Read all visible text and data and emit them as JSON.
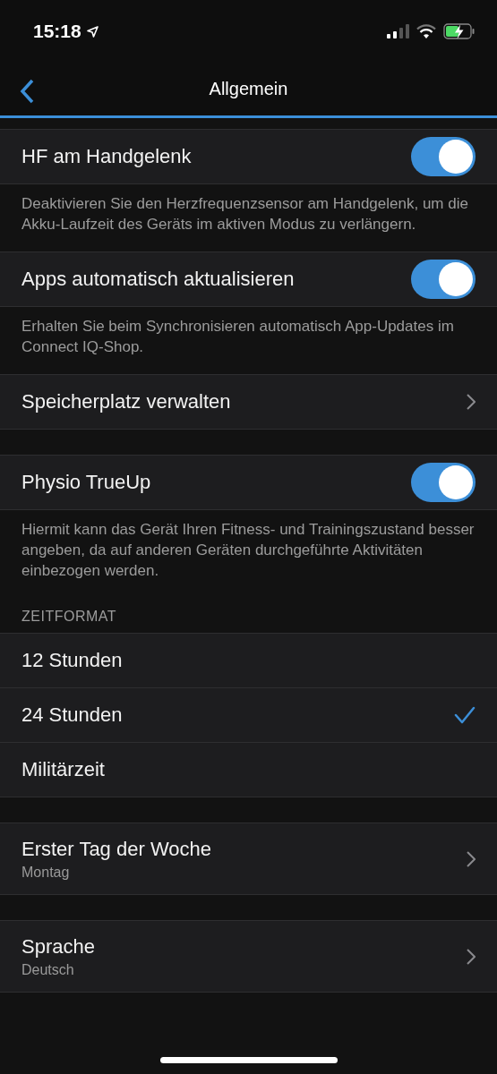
{
  "status_bar": {
    "time": "15:18"
  },
  "nav": {
    "title": "Allgemein"
  },
  "groups": [
    {
      "rows": [
        {
          "kind": "toggle",
          "label": "HF am Handgelenk",
          "on": true
        },
        {
          "kind": "note",
          "text": "Deaktivieren Sie den Herzfrequenzsensor am Handgelenk, um die Akku-Laufzeit des Geräts im aktiven Modus zu verlängern."
        },
        {
          "kind": "toggle",
          "label": "Apps automatisch aktualisieren",
          "on": true
        },
        {
          "kind": "note",
          "text": "Erhalten Sie beim Synchronisieren automatisch App-Updates im Connect IQ-Shop."
        },
        {
          "kind": "link",
          "label": "Speicherplatz verwalten"
        }
      ]
    },
    {
      "rows": [
        {
          "kind": "toggle",
          "label": "Physio TrueUp",
          "on": true
        },
        {
          "kind": "note",
          "text": "Hiermit kann das Gerät Ihren Fitness- und Trainingszustand besser angeben, da auf anderen Geräten durchgeführte Aktivitäten einbezogen werden."
        },
        {
          "kind": "header",
          "text": "ZEITFORMAT"
        },
        {
          "kind": "option",
          "label": "12 Stunden",
          "selected": false
        },
        {
          "kind": "option",
          "label": "24 Stunden",
          "selected": true
        },
        {
          "kind": "option",
          "label": "Militärzeit",
          "selected": false
        }
      ]
    },
    {
      "rows": [
        {
          "kind": "link",
          "label": "Erster Tag der Woche",
          "value": "Montag"
        }
      ]
    },
    {
      "rows": [
        {
          "kind": "link",
          "label": "Sprache",
          "value": "Deutsch"
        }
      ]
    }
  ]
}
